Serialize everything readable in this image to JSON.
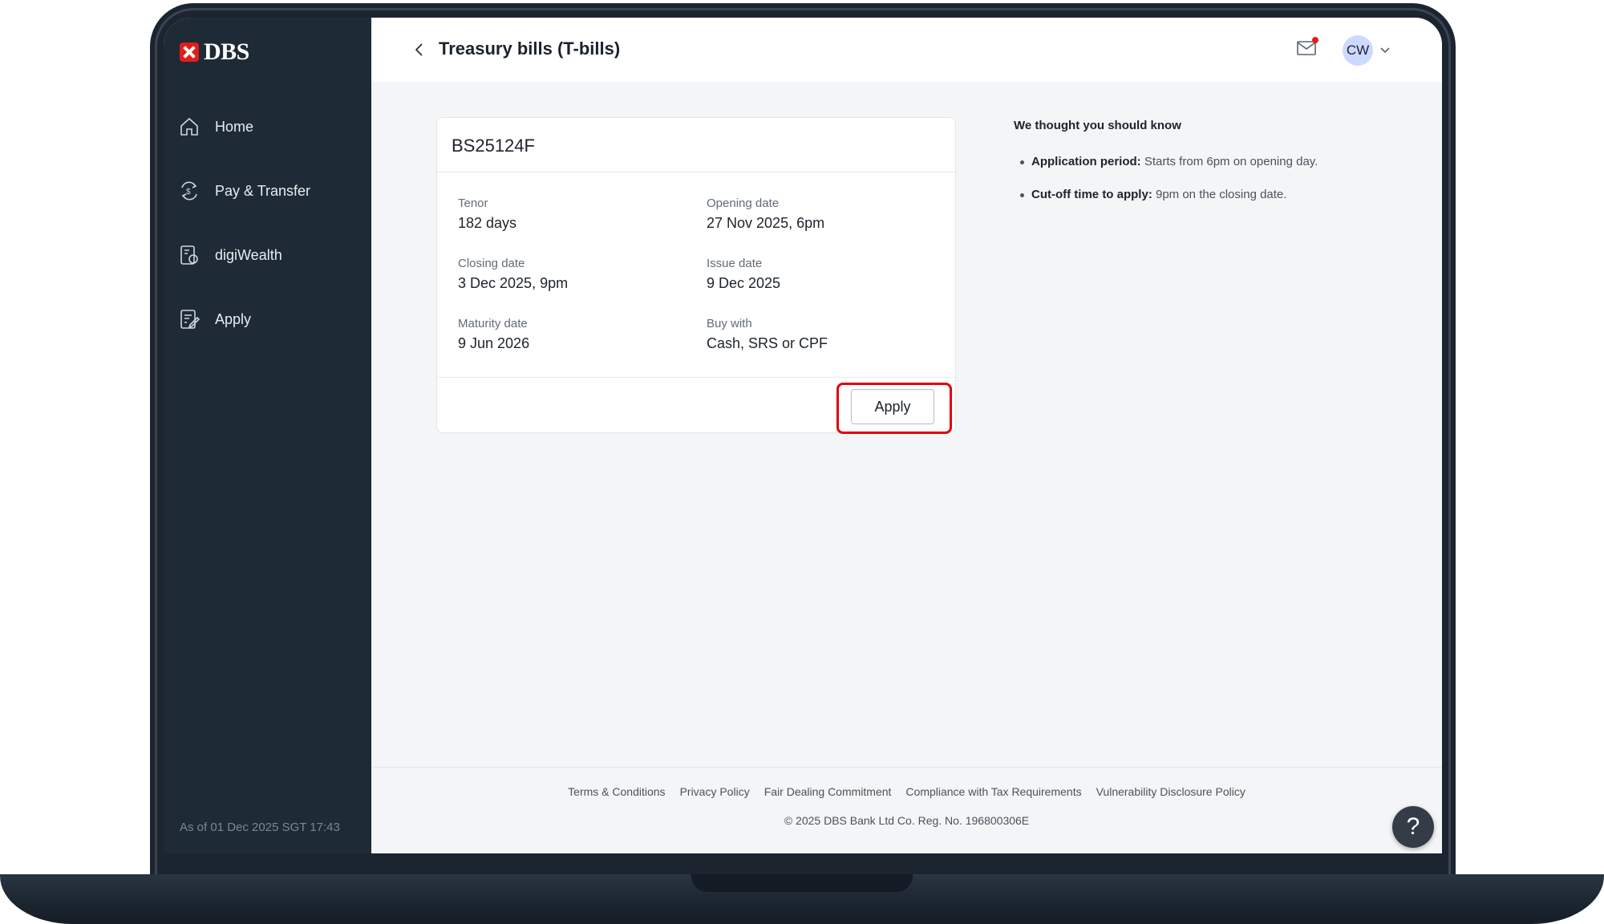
{
  "brand": {
    "name": "DBS",
    "accent": "#e31d1a"
  },
  "sidebar": {
    "items": [
      {
        "label": "Home",
        "icon": "home-icon"
      },
      {
        "label": "Pay & Transfer",
        "icon": "pay-transfer-icon"
      },
      {
        "label": "digiWealth",
        "icon": "digiwealth-icon"
      },
      {
        "label": "Apply",
        "icon": "apply-form-icon"
      }
    ],
    "as_of": "As of 01 Dec 2025 SGT 17:43"
  },
  "header": {
    "title": "Treasury bills (T-bills)",
    "avatar_initials": "CW"
  },
  "card": {
    "title": "BS25124F",
    "fields": [
      {
        "label": "Tenor",
        "value": "182 days"
      },
      {
        "label": "Opening date",
        "value": "27 Nov 2025, 6pm"
      },
      {
        "label": "Closing date",
        "value": "3 Dec 2025, 9pm"
      },
      {
        "label": "Issue date",
        "value": "9 Dec 2025"
      },
      {
        "label": "Maturity date",
        "value": "9 Jun 2026"
      },
      {
        "label": "Buy with",
        "value": "Cash, SRS or CPF"
      }
    ],
    "apply_label": "Apply"
  },
  "info": {
    "title": "We thought you should know",
    "items": [
      {
        "bold": "Application period:",
        "text": " Starts from 6pm on opening day."
      },
      {
        "bold": "Cut-off time to apply:",
        "text": " 9pm on the closing date."
      }
    ]
  },
  "footer": {
    "links": [
      "Terms & Conditions",
      "Privacy Policy",
      "Fair Dealing Commitment",
      "Compliance with Tax Requirements",
      "Vulnerability Disclosure Policy"
    ],
    "copyright": "© 2025 DBS Bank Ltd  Co. Reg. No. 196800306E",
    "help_label": "?"
  }
}
